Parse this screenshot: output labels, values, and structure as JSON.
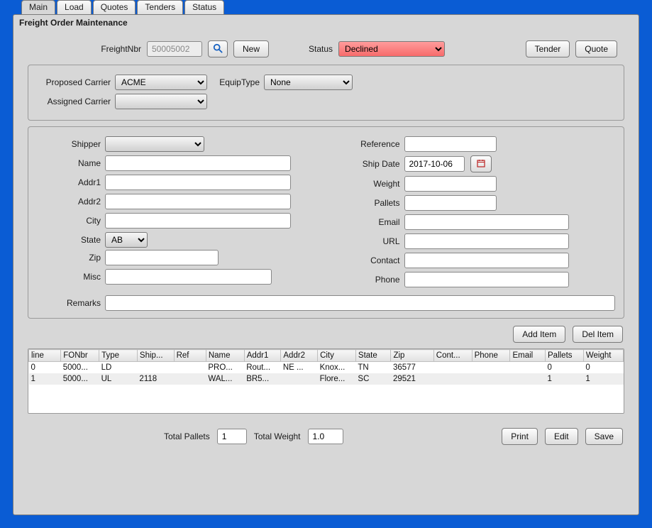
{
  "tabs": {
    "main": "Main",
    "load": "Load",
    "quotes": "Quotes",
    "tenders": "Tenders",
    "status": "Status"
  },
  "panel_title": "Freight Order Maintenance",
  "top": {
    "freight_lbl": "FreightNbr",
    "freight_val": "50005002",
    "new_btn": "New",
    "status_lbl": "Status",
    "status_val": "Declined",
    "tender_btn": "Tender",
    "quote_btn": "Quote"
  },
  "carrier": {
    "proposed_lbl": "Proposed Carrier",
    "proposed_val": "ACME",
    "assigned_lbl": "Assigned Carrier",
    "assigned_val": "",
    "equip_lbl": "EquipType",
    "equip_val": "None"
  },
  "left": {
    "shipper_lbl": "Shipper",
    "shipper_val": "",
    "name_lbl": "Name",
    "name_val": "",
    "addr1_lbl": "Addr1",
    "addr1_val": "",
    "addr2_lbl": "Addr2",
    "addr2_val": "",
    "city_lbl": "City",
    "city_val": "",
    "state_lbl": "State",
    "state_val": "AB",
    "zip_lbl": "Zip",
    "zip_val": "",
    "misc_lbl": "Misc",
    "misc_val": ""
  },
  "right": {
    "reference_lbl": "Reference",
    "reference_val": "",
    "shipdate_lbl": "Ship Date",
    "shipdate_val": "2017-10-06",
    "weight_lbl": "Weight",
    "weight_val": "",
    "pallets_lbl": "Pallets",
    "pallets_val": "",
    "email_lbl": "Email",
    "email_val": "",
    "url_lbl": "URL",
    "url_val": "",
    "contact_lbl": "Contact",
    "contact_val": "",
    "phone_lbl": "Phone",
    "phone_val": ""
  },
  "remarks_lbl": "Remarks",
  "remarks_val": "",
  "items": {
    "add_btn": "Add Item",
    "del_btn": "Del Item",
    "headers": {
      "line": "line",
      "fonbr": "FONbr",
      "type": "Type",
      "ship": "Ship...",
      "ref": "Ref",
      "name": "Name",
      "addr1": "Addr1",
      "addr2": "Addr2",
      "city": "City",
      "state": "State",
      "zip": "Zip",
      "cont": "Cont...",
      "phone": "Phone",
      "email": "Email",
      "pallets": "Pallets",
      "weight": "Weight"
    },
    "rows": [
      {
        "line": "0",
        "fonbr": "5000...",
        "type": "LD",
        "ship": "",
        "ref": "",
        "name": "PRO...",
        "addr1": "Rout...",
        "addr2": "NE ...",
        "city": "Knox...",
        "state": "TN",
        "zip": "36577",
        "cont": "",
        "phone": "",
        "email": "",
        "pallets": "0",
        "weight": "0"
      },
      {
        "line": "1",
        "fonbr": "5000...",
        "type": "UL",
        "ship": "2118",
        "ref": "",
        "name": "WAL...",
        "addr1": "BR5...",
        "addr2": "",
        "city": "Flore...",
        "state": "SC",
        "zip": "29521",
        "cont": "",
        "phone": "",
        "email": "",
        "pallets": "1",
        "weight": "1"
      }
    ]
  },
  "bottom": {
    "total_pallets_lbl": "Total Pallets",
    "total_pallets_val": "1",
    "total_weight_lbl": "Total Weight",
    "total_weight_val": "1.0",
    "print_btn": "Print",
    "edit_btn": "Edit",
    "save_btn": "Save"
  }
}
